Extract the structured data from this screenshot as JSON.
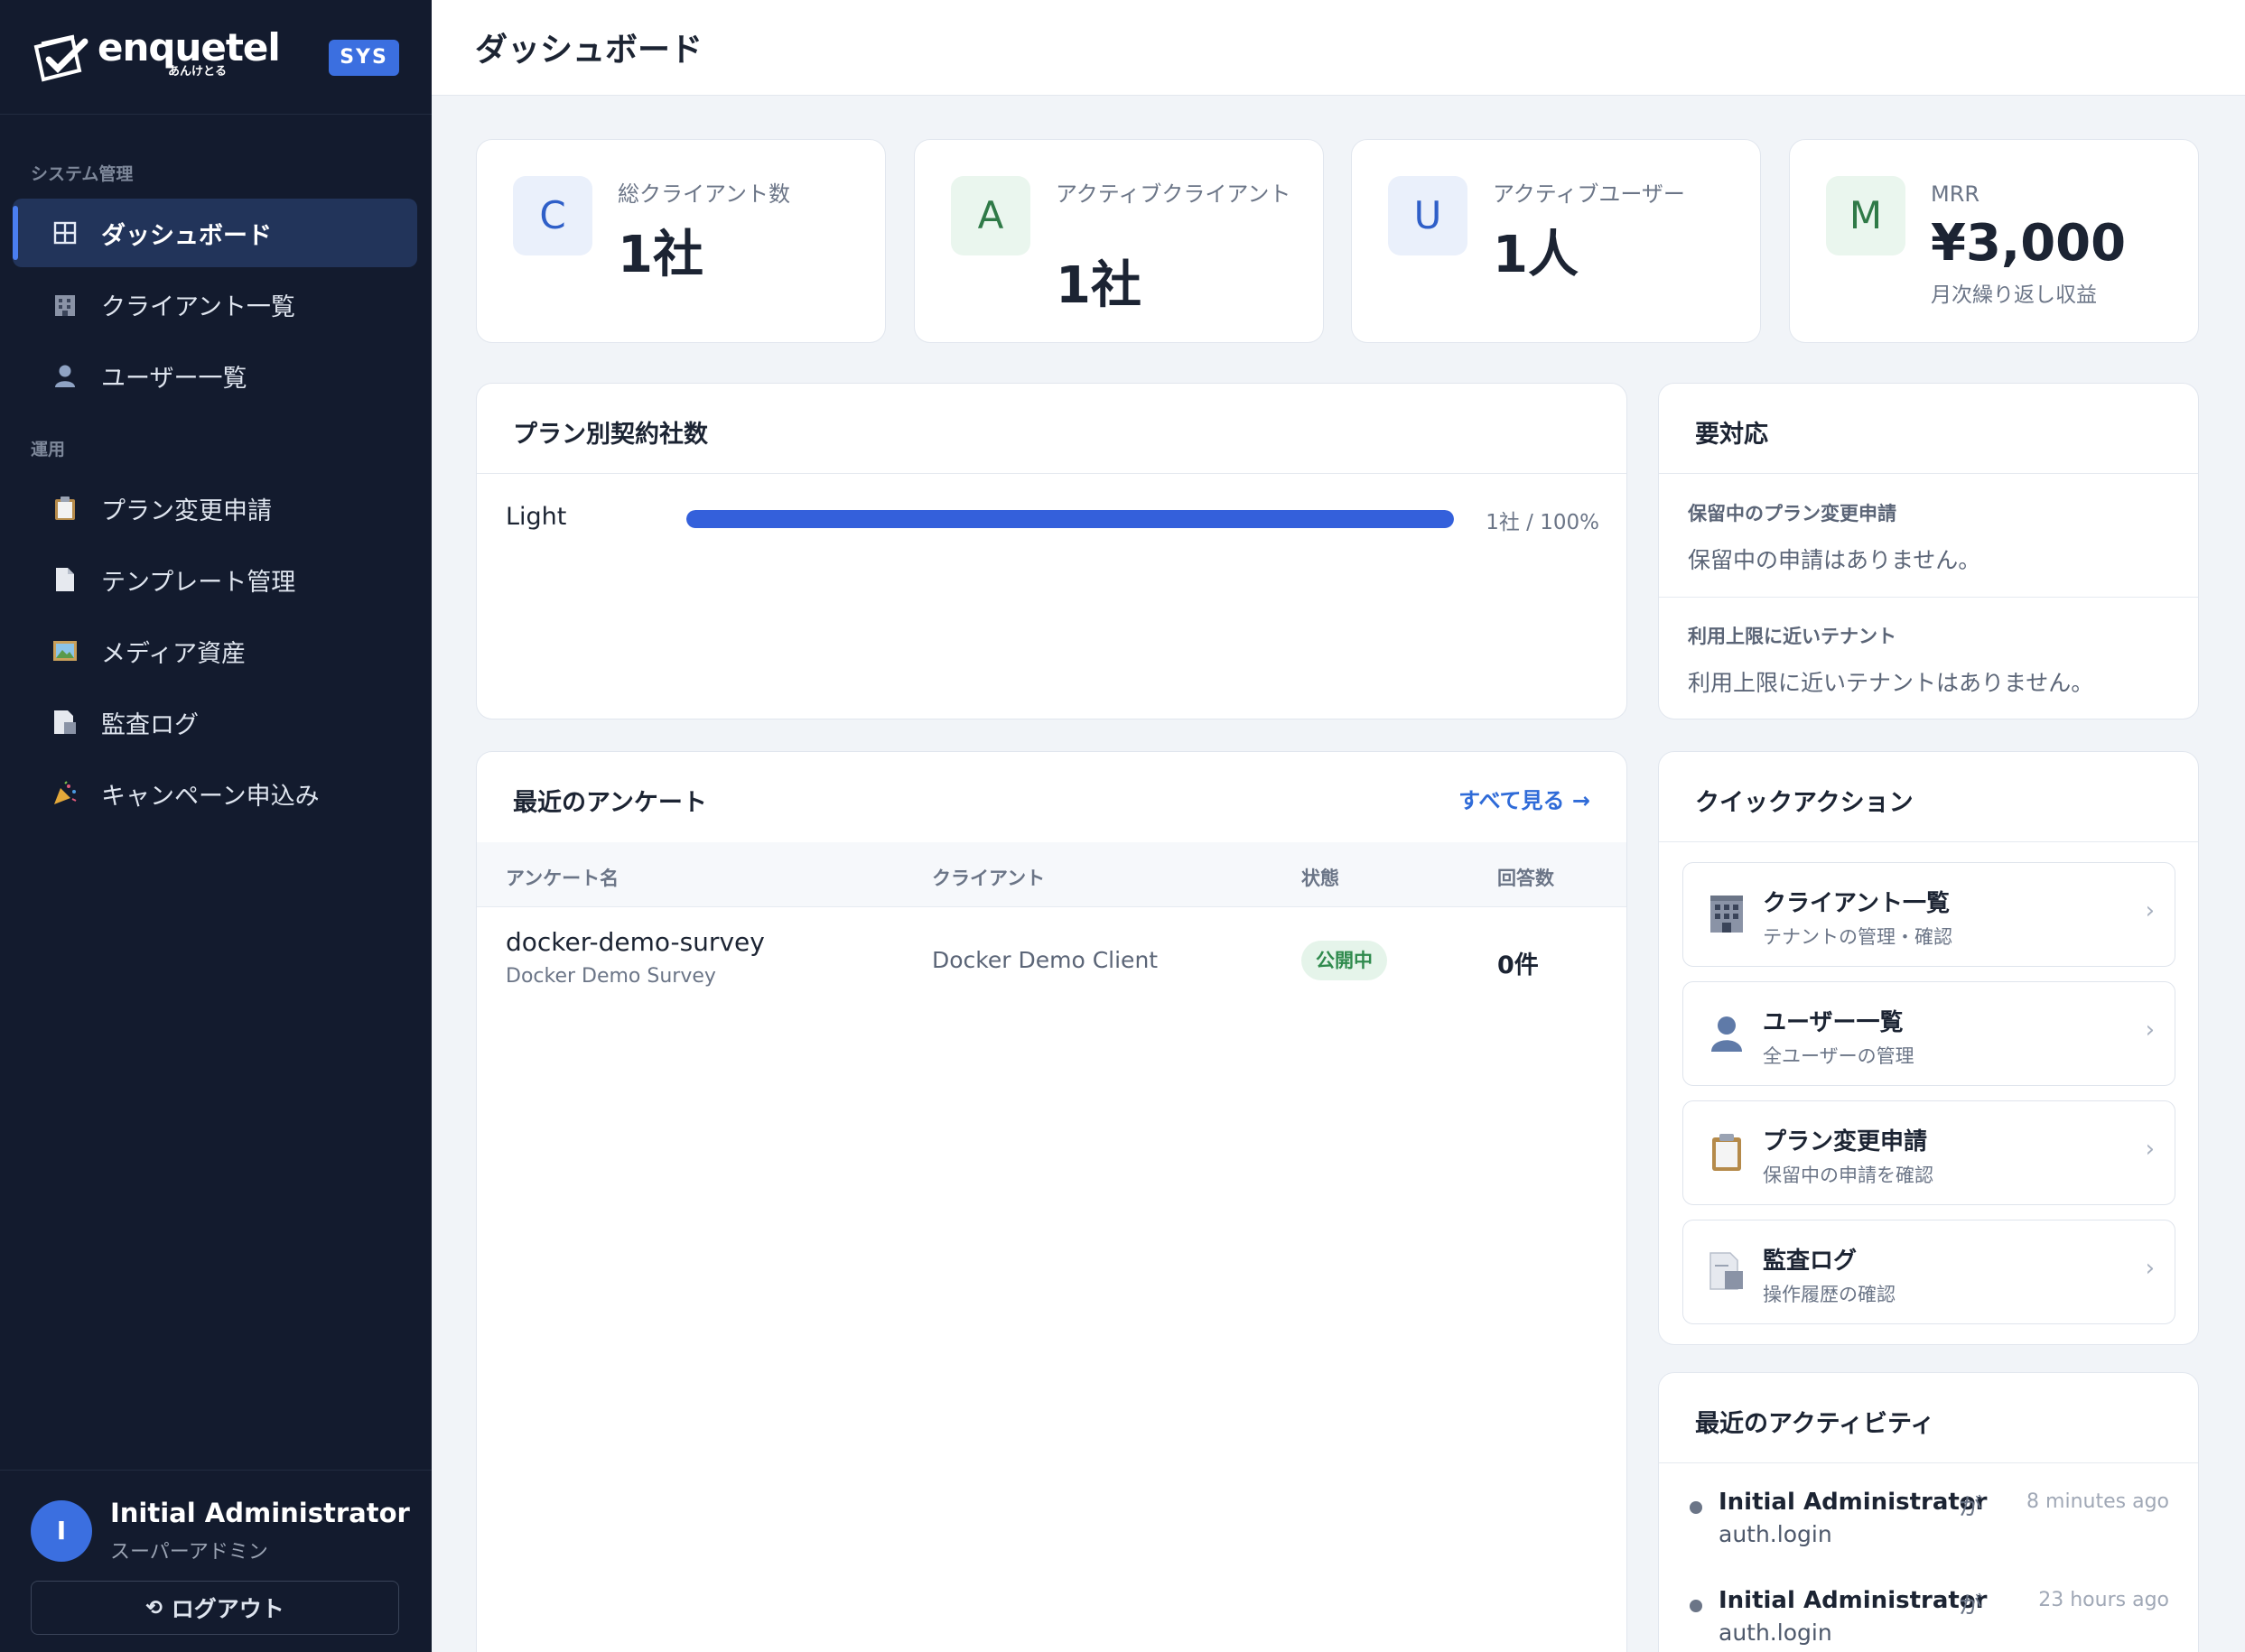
{
  "brand": {
    "name": "enquetel",
    "sub": "あんけとる",
    "badge": "SYS"
  },
  "sidebar": {
    "sections": [
      "システム管理",
      "運用"
    ],
    "items": [
      {
        "label": "ダッシュボード",
        "icon": "grid-icon"
      },
      {
        "label": "クライアント一覧",
        "icon": "building-icon"
      },
      {
        "label": "ユーザー一覧",
        "icon": "user-icon"
      },
      {
        "label": "プラン変更申請",
        "icon": "clipboard-icon"
      },
      {
        "label": "テンプレート管理",
        "icon": "document-icon"
      },
      {
        "label": "メディア資産",
        "icon": "image-icon"
      },
      {
        "label": "監査ログ",
        "icon": "log-icon"
      },
      {
        "label": "キャンペーン申込み",
        "icon": "party-popper-icon"
      }
    ],
    "user": {
      "initial": "I",
      "name": "Initial Administrator",
      "role": "スーパーアドミン"
    },
    "logout": "ログアウト"
  },
  "header": {
    "title": "ダッシュボード"
  },
  "stats": [
    {
      "letter": "C",
      "label": "総クライアント数",
      "value": "1社",
      "sub": ""
    },
    {
      "letter": "A",
      "label": "アクティブクライアント",
      "value": "1社",
      "sub": ""
    },
    {
      "letter": "U",
      "label": "アクティブユーザー",
      "value": "1人",
      "sub": ""
    },
    {
      "letter": "M",
      "label": "MRR",
      "value": "¥3,000",
      "sub": "月次繰り返し収益"
    }
  ],
  "plans": {
    "title": "プラン別契約社数",
    "rows": [
      {
        "name": "Light",
        "count_label": "1社 / 100%",
        "ratio": 1.0
      }
    ]
  },
  "todo": {
    "title": "要対応",
    "sections": [
      {
        "heading": "保留中のプラン変更申請",
        "text": "保留中の申請はありません。"
      },
      {
        "heading": "利用上限に近いテナント",
        "text": "利用上限に近いテナントはありません。"
      }
    ]
  },
  "surveys": {
    "title": "最近のアンケート",
    "see_all": "すべて見る →",
    "columns": [
      "アンケート名",
      "クライアント",
      "状態",
      "回答数"
    ],
    "rows": [
      {
        "name": "docker-demo-survey",
        "subtitle": "Docker Demo Survey",
        "client": "Docker Demo Client",
        "status": "公開中",
        "responses": "0件"
      }
    ]
  },
  "quick_actions": {
    "title": "クイックアクション",
    "items": [
      {
        "title": "クライアント一覧",
        "desc": "テナントの管理・確認",
        "icon": "building-icon"
      },
      {
        "title": "ユーザー一覧",
        "desc": "全ユーザーの管理",
        "icon": "user-icon"
      },
      {
        "title": "プラン変更申請",
        "desc": "保留中の申請を確認",
        "icon": "clipboard-icon"
      },
      {
        "title": "監査ログ",
        "desc": "操作履歴の確認",
        "icon": "log-icon"
      }
    ]
  },
  "activity": {
    "title": "最近のアクティビティ",
    "items": [
      {
        "actor": "Initial Administrator",
        "particle": "が",
        "action": "auth.login",
        "time": "8 minutes ago"
      },
      {
        "actor": "Initial Administrator",
        "particle": "が",
        "action": "auth.login",
        "time": "23 hours ago"
      }
    ]
  }
}
